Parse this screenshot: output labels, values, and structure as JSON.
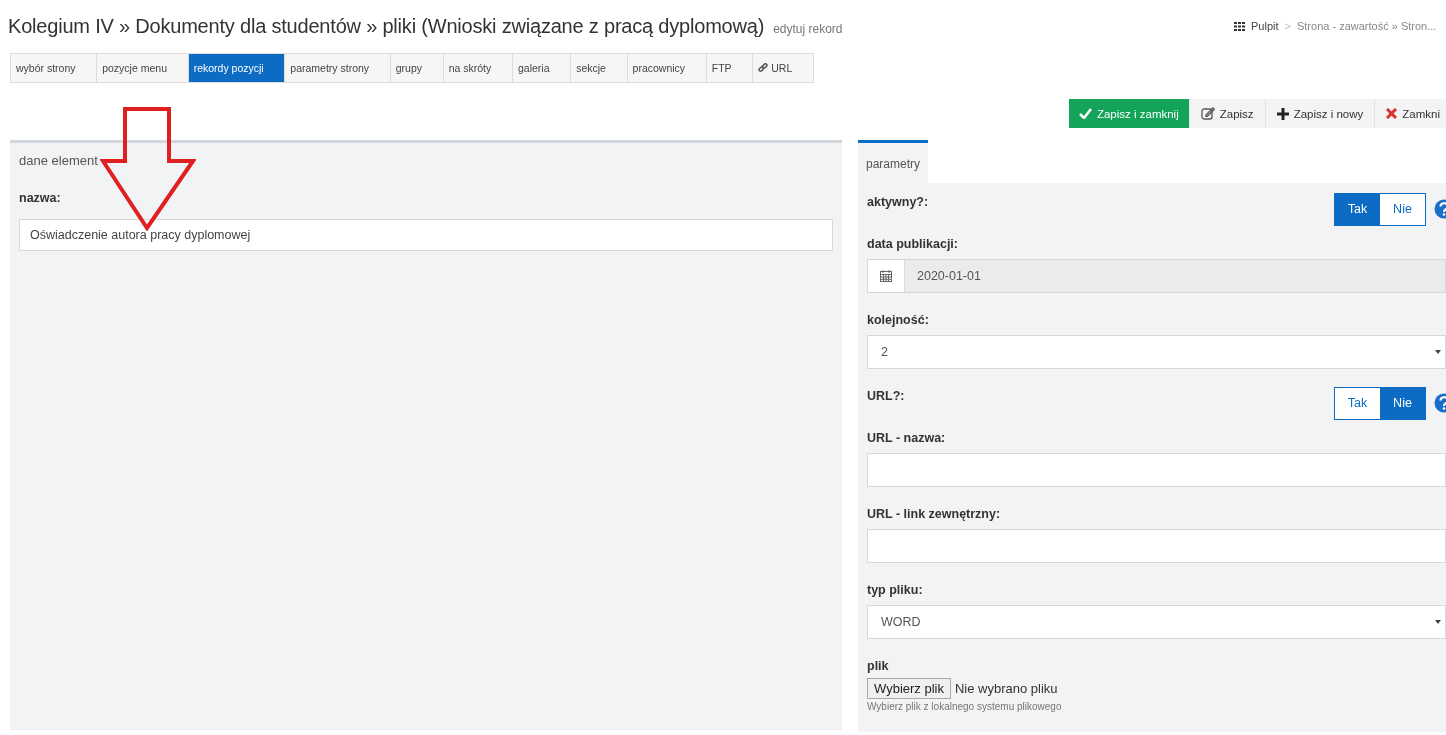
{
  "header": {
    "title": "Kolegium IV » Dokumenty dla studentów » pliki (Wnioski związane z pracą dyplomową)",
    "subtitle": "edytuj rekord"
  },
  "breadcrumb": {
    "home": "Pulpit",
    "separator": ">",
    "path": "Strona - zawartość » Stron..."
  },
  "tabs": [
    {
      "label": "wybór strony",
      "selected": false
    },
    {
      "label": "pozycje menu",
      "selected": false
    },
    {
      "label": "rekordy pozycji",
      "selected": true
    },
    {
      "label": "parametry strony",
      "selected": false
    },
    {
      "label": "grupy",
      "selected": false
    },
    {
      "label": "na skróty",
      "selected": false
    },
    {
      "label": "galeria",
      "selected": false
    },
    {
      "label": "sekcje",
      "selected": false
    },
    {
      "label": "pracownicy",
      "selected": false
    },
    {
      "label": "FTP",
      "selected": false
    },
    {
      "label": "URL",
      "selected": false,
      "kind": "link"
    }
  ],
  "actions": [
    {
      "label": "Zapisz i zamknij",
      "kind": "save-close"
    },
    {
      "label": "Zapisz",
      "kind": "save"
    },
    {
      "label": "Zapisz i nowy",
      "kind": "save-new"
    },
    {
      "label": "Zamkni",
      "kind": "close"
    }
  ],
  "left_panel": {
    "title": "dane element",
    "fields": [
      {
        "label": "nazwa:",
        "value": "Oświadczenie autora pracy dyplomowej"
      }
    ]
  },
  "right_panel": {
    "tab": "parametry",
    "fields": [
      {
        "kind": "toggle",
        "label": "aktywny?:",
        "options": [
          {
            "label": "Tak",
            "selected": true
          },
          {
            "label": "Nie",
            "selected": false
          }
        ]
      },
      {
        "kind": "date",
        "label": "data publikacji:",
        "value": "2020-01-01"
      },
      {
        "kind": "select",
        "label": "kolejność:",
        "value": "2"
      },
      {
        "kind": "toggle",
        "label": "URL?:",
        "options": [
          {
            "label": "Tak",
            "selected": false
          },
          {
            "label": "Nie",
            "selected": true
          }
        ]
      },
      {
        "kind": "text",
        "label": "URL - nazwa:"
      },
      {
        "kind": "text",
        "label": "URL - link zewnętrzny:"
      },
      {
        "kind": "select",
        "label": "typ pliku:",
        "value": "WORD"
      },
      {
        "kind": "file",
        "label": "plik",
        "button": "Wybierz plik",
        "status": "Nie wybrano pliku",
        "help": "Wybierz plik z lokalnego systemu plikowego"
      }
    ]
  }
}
